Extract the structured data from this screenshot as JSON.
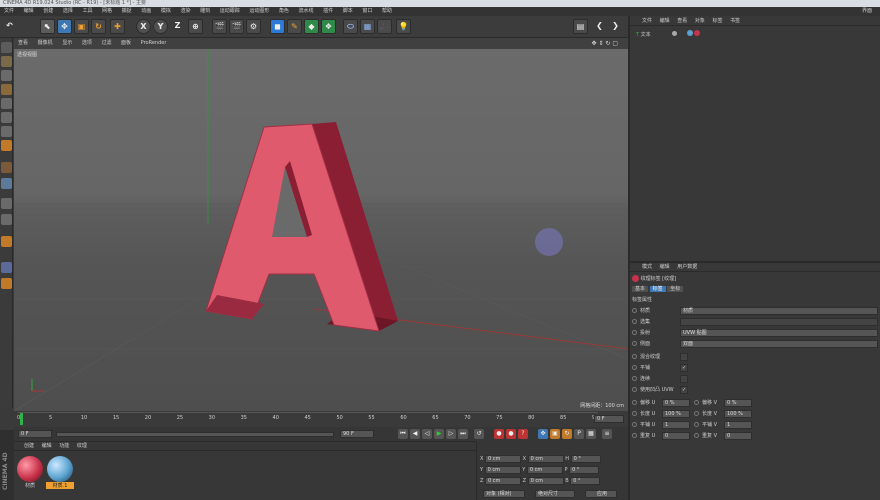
{
  "window": {
    "title": "CINEMA 4D R19.024 Studio (RC - R19) - [未标题 1 *] - 主要"
  },
  "menubar": {
    "items": [
      "文件",
      "编辑",
      "创建",
      "选择",
      "工具",
      "网格",
      "捕捉",
      "动画",
      "模拟",
      "渲染",
      "雕刻",
      "运动跟踪",
      "运动图形",
      "角色",
      "流水线",
      "插件",
      "脚本",
      "窗口",
      "帮助"
    ],
    "layout_label": "界面"
  },
  "toolbar": {
    "axis_x": "X",
    "axis_y": "Y",
    "axis_z": "Z"
  },
  "viewport": {
    "menu": [
      "查看",
      "摄像机",
      "显示",
      "选项",
      "过滤",
      "面板",
      "ProRender"
    ],
    "label": "透视视图",
    "grid_scale": "网格间距：100 cm",
    "object_letter": "A"
  },
  "timeline": {
    "ticks": [
      "0",
      "5",
      "10",
      "15",
      "20",
      "25",
      "30",
      "35",
      "40",
      "45",
      "50",
      "55",
      "60",
      "65",
      "70",
      "75",
      "80",
      "85",
      "90"
    ],
    "current_frame": "0 F"
  },
  "playbar": {
    "start_field": "0 F",
    "end_field": "90 F"
  },
  "materials": {
    "menu": [
      "创建",
      "编辑",
      "功能",
      "纹理"
    ],
    "items": [
      {
        "label": "材质",
        "color": "#c8324a"
      },
      {
        "label": "材质.1",
        "color": "#5aa2cf"
      }
    ]
  },
  "coordinates": {
    "rows": [
      {
        "axis": "X",
        "pos": "0 cm",
        "axis2": "X",
        "size": "0 cm",
        "rot_axis": "H",
        "rot": "0 °"
      },
      {
        "axis": "Y",
        "pos": "0 cm",
        "axis2": "Y",
        "size": "0 cm",
        "rot_axis": "P",
        "rot": "0 °"
      },
      {
        "axis": "Z",
        "pos": "0 cm",
        "axis2": "Z",
        "size": "0 cm",
        "rot_axis": "B",
        "rot": "0 °"
      }
    ],
    "mode_select": "对象 (相对)",
    "size_select": "绝对尺寸",
    "apply_label": "应用"
  },
  "object_manager": {
    "menu": [
      "文件",
      "编辑",
      "查看",
      "对象",
      "标签",
      "书签"
    ],
    "object_name": "文本"
  },
  "attributes": {
    "menu": [
      "模式",
      "编辑",
      "用户数据"
    ],
    "tag_title": "纹理标签 [纹理]",
    "tabs": [
      "基本",
      "标签",
      "坐标"
    ],
    "section": "标签属性",
    "rows": [
      {
        "label": "材质",
        "value": "材质"
      },
      {
        "label": "选集",
        "value": ""
      },
      {
        "label": "投射",
        "value": "UVW 贴图"
      },
      {
        "label": "侧面",
        "value": "双面"
      },
      {
        "label": "混合纹理",
        "value": ""
      },
      {
        "label": "平铺",
        "value": "✓"
      },
      {
        "label": "连续",
        "value": ""
      },
      {
        "label": "使用凹凸 UVW",
        "value": "✓"
      }
    ],
    "offset_u": {
      "label": "偏移 U",
      "value": "0 %"
    },
    "offset_v": {
      "label": "偏移 V",
      "value": "0 %"
    },
    "length_u": {
      "label": "长度 U",
      "value": "100 %"
    },
    "length_v": {
      "label": "长度 V",
      "value": "100 %"
    },
    "tiles_u": {
      "label": "平铺 U",
      "value": "1"
    },
    "tiles_v": {
      "label": "平铺 V",
      "value": "1"
    },
    "repeat_u": {
      "label": "重复 U",
      "value": "0"
    },
    "repeat_v": {
      "label": "重复 V",
      "value": "0"
    }
  },
  "brand": {
    "text": "CINEMA 4D"
  },
  "colors": {
    "accent": "#3d78b5",
    "letter_face": "#e05a6e",
    "letter_side": "#8a1e33"
  }
}
